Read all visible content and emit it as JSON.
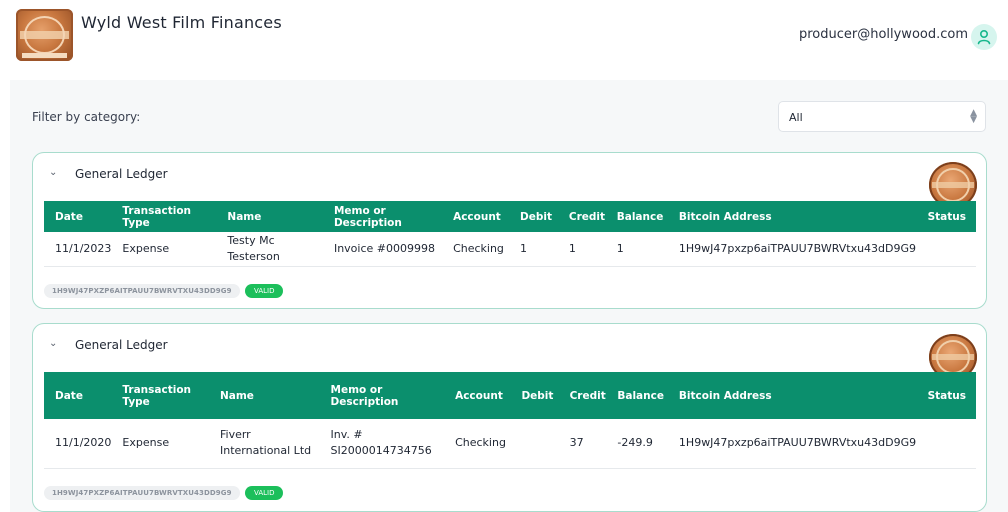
{
  "header": {
    "app_title": "Wyld West Film Finances",
    "user_email": "producer@hollywood.com"
  },
  "filter": {
    "label": "Filter by category:",
    "selected": "All"
  },
  "ledgers": [
    {
      "title": "General Ledger",
      "columns": [
        "Date",
        "Transaction Type",
        "Name",
        "Memo or Description",
        "Account",
        "Debit",
        "Credit",
        "Balance",
        "Bitcoin Address",
        "Status"
      ],
      "rows": [
        {
          "date": "11/1/2023",
          "type": "Expense",
          "name": "Testy Mc Testerson",
          "memo": "Invoice #0009998",
          "account": "Checking",
          "debit": "1",
          "credit": "1",
          "balance": "1",
          "bitcoin": "1H9wJ47pxzp6aiTPAUU7BWRVtxu43dD9G9",
          "status": ""
        }
      ],
      "hash": "1H9WJ47PXZP6AITPAUU7BWRVTXU43DD9G9",
      "valid_label": "VALID"
    },
    {
      "title": "General Ledger",
      "columns": [
        "Date",
        "Transaction Type",
        "Name",
        "Memo or Description",
        "Account",
        "Debit",
        "Credit",
        "Balance",
        "Bitcoin Address",
        "Status"
      ],
      "rows": [
        {
          "date": "11/1/2020",
          "type": "Expense",
          "name": "Fiverr International Ltd",
          "memo": "Inv. # SI2000014734756",
          "account": "Checking",
          "debit": "",
          "credit": "37",
          "balance": "-249.9",
          "bitcoin": "1H9wJ47pxzp6aiTPAUU7BWRVtxu43dD9G9",
          "status": ""
        }
      ],
      "hash": "1H9WJ47PXZP6AITPAUU7BWRVTXU43DD9G9",
      "valid_label": "VALID"
    }
  ],
  "colors": {
    "table_header": "#0b8f6d",
    "valid": "#1cbf5b",
    "card_border": "#a8dccd"
  }
}
